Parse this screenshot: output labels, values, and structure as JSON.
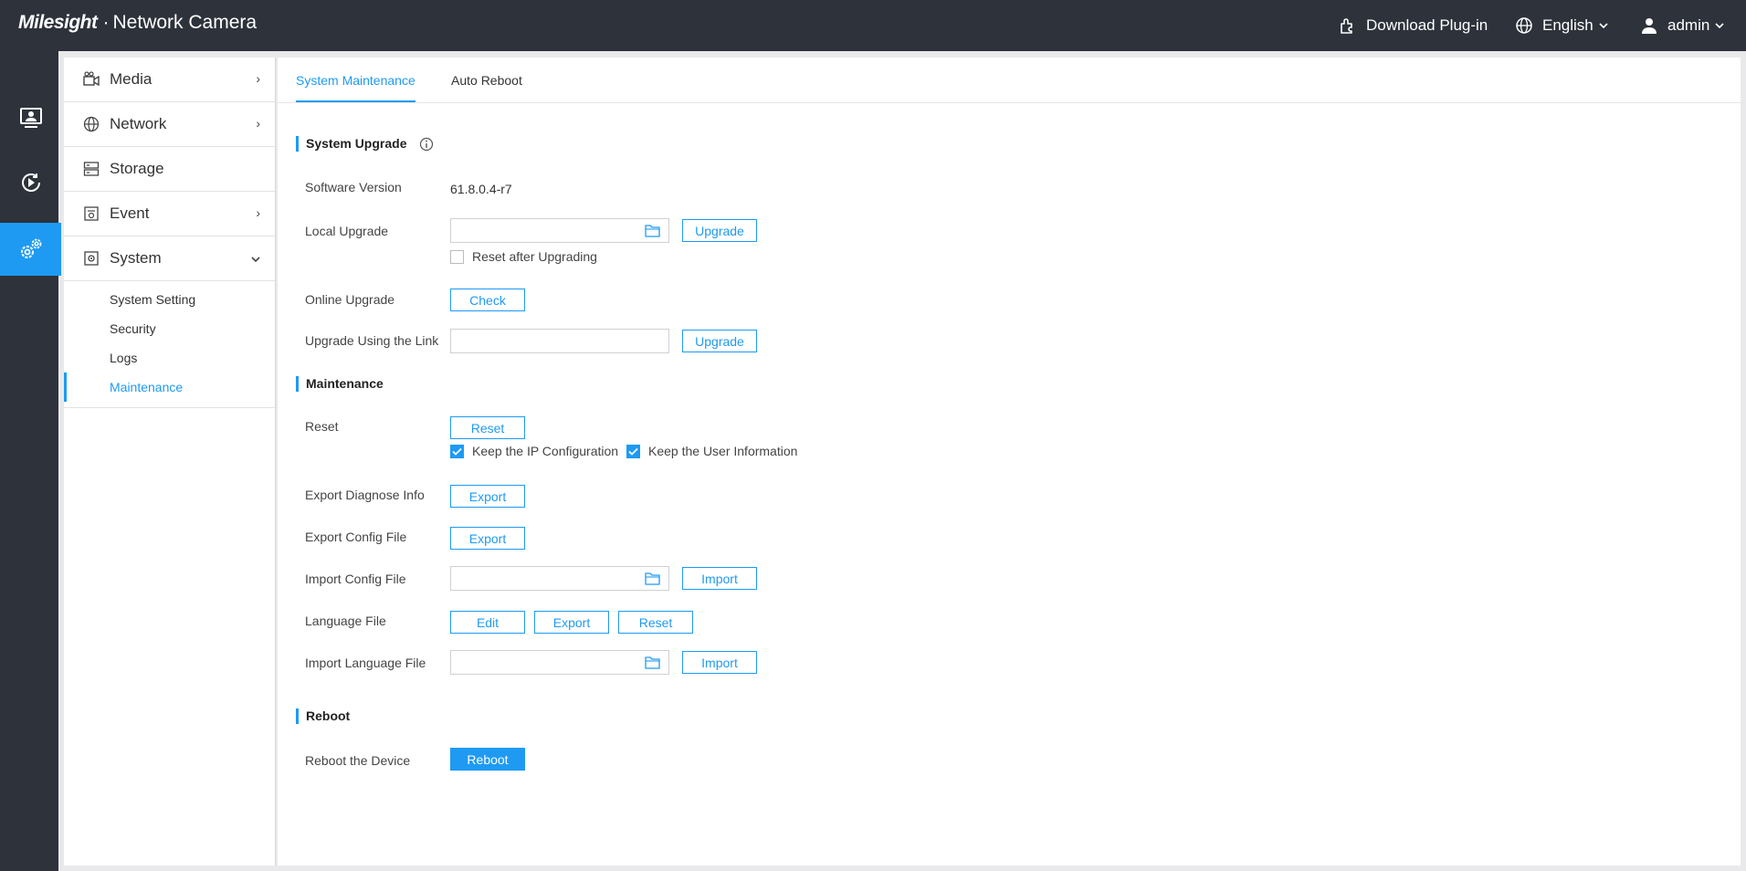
{
  "header": {
    "logo_brand": "Milesight",
    "logo_product": "Network Camera",
    "download_label": "Download Plug-in",
    "language_label": "English",
    "user_label": "admin"
  },
  "rail": {
    "items": [
      {
        "icon": "live-view-icon",
        "active": false
      },
      {
        "icon": "playback-icon",
        "active": false
      },
      {
        "icon": "settings-icon",
        "active": true
      }
    ]
  },
  "menu": {
    "items": [
      {
        "label": "Media",
        "icon": "media-icon",
        "arrow": "›"
      },
      {
        "label": "Network",
        "icon": "globe-icon",
        "arrow": "›"
      },
      {
        "label": "Storage",
        "icon": "storage-icon",
        "arrow": ""
      },
      {
        "label": "Event",
        "icon": "event-icon",
        "arrow": "›"
      },
      {
        "label": "System",
        "icon": "system-icon",
        "arrow": "⌄"
      }
    ],
    "system_sub": [
      "System Setting",
      "Security",
      "Logs",
      "Maintenance"
    ],
    "active_sub": "Maintenance"
  },
  "tabs": [
    "System Maintenance",
    "Auto Reboot"
  ],
  "upgrade": {
    "title": "System Upgrade",
    "software_version_label": "Software Version",
    "software_version": "61.8.0.4-r7",
    "local_upgrade_label": "Local Upgrade",
    "upgrade_btn": "Upgrade",
    "reset_after_upgrading": "Reset after Upgrading",
    "online_upgrade_label": "Online Upgrade",
    "check_btn": "Check",
    "upgrade_link_label": "Upgrade Using the Link"
  },
  "maintenance": {
    "title": "Maintenance",
    "reset_label": "Reset",
    "reset_btn": "Reset",
    "keep_ip": "Keep the IP Configuration",
    "keep_user": "Keep the User Information",
    "export_diagnose_label": "Export Diagnose Info",
    "export_btn": "Export",
    "export_config_label": "Export Config File",
    "import_config_label": "Import Config File",
    "import_btn": "Import",
    "language_file_label": "Language File",
    "edit_btn": "Edit",
    "import_language_label": "Import Language File"
  },
  "reboot": {
    "title": "Reboot",
    "reboot_device_label": "Reboot the Device",
    "reboot_btn": "Reboot"
  },
  "colors": {
    "accent": "#1e9af3",
    "header_bg": "#2d323b"
  }
}
